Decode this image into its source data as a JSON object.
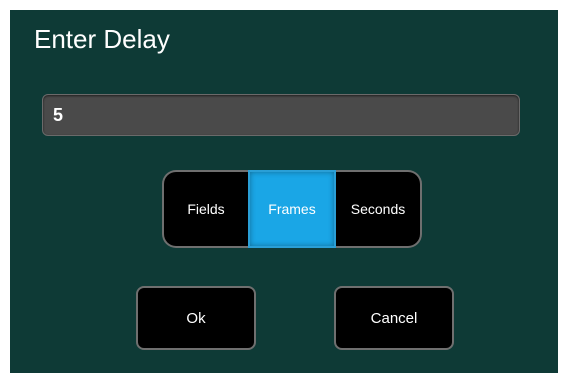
{
  "dialog": {
    "title": "Enter Delay",
    "value": "5",
    "units": {
      "options": [
        "Fields",
        "Frames",
        "Seconds"
      ],
      "selected": "Frames"
    },
    "buttons": {
      "ok": "Ok",
      "cancel": "Cancel"
    },
    "colors": {
      "background": "#0e3a36",
      "selected": "#1aa6e6",
      "button": "#000000",
      "field": "#4a4a4a"
    }
  }
}
